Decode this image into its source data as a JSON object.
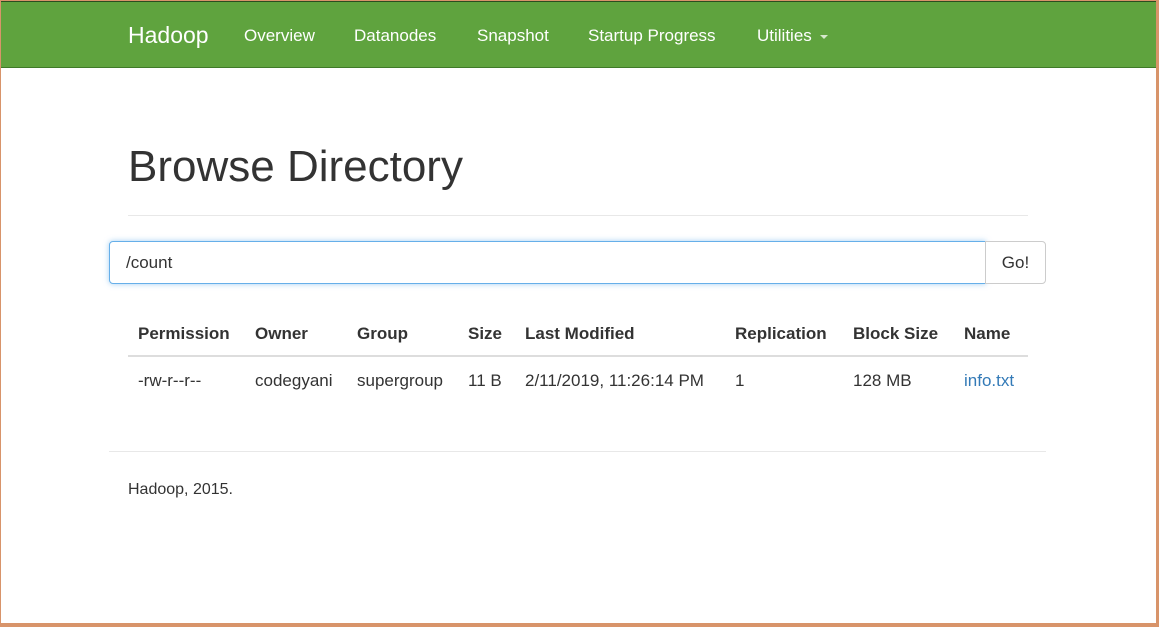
{
  "navbar": {
    "brand": "Hadoop",
    "items": [
      {
        "label": "Overview"
      },
      {
        "label": "Datanodes"
      },
      {
        "label": "Snapshot"
      },
      {
        "label": "Startup Progress"
      },
      {
        "label": "Utilities"
      }
    ],
    "color": "#5fa33e"
  },
  "page": {
    "title": "Browse Directory"
  },
  "path_form": {
    "value": "/count",
    "button_label": "Go!"
  },
  "table": {
    "headers": [
      "Permission",
      "Owner",
      "Group",
      "Size",
      "Last Modified",
      "Replication",
      "Block Size",
      "Name"
    ],
    "rows": [
      {
        "permission": "-rw-r--r--",
        "owner": "codegyani",
        "group": "supergroup",
        "size": "11 B",
        "last_modified": "2/11/2019, 11:26:14 PM",
        "replication": "1",
        "block_size": "128 MB",
        "name": "info.txt"
      }
    ],
    "link_color": "#337ab7"
  },
  "footer": {
    "text": "Hadoop, 2015."
  }
}
